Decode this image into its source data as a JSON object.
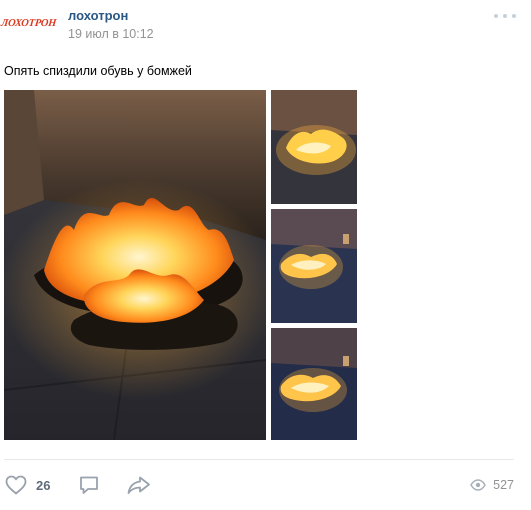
{
  "post": {
    "author": {
      "logo_text": "ЛОХОТРОН",
      "name": "лохотрон"
    },
    "date": "19 июл в 10:12",
    "menu_icon": "more-horizontal-icon",
    "text": "Опять спиздили обувь у бомжей",
    "photos": [
      {
        "role": "main",
        "subject": "burning shoes on pavement"
      },
      {
        "role": "thumbnail",
        "subject": "burning shoes"
      },
      {
        "role": "thumbnail",
        "subject": "burning shoes"
      },
      {
        "role": "thumbnail",
        "subject": "burning shoes"
      }
    ],
    "actions": {
      "like_icon": "heart-icon",
      "likes": "26",
      "comment_icon": "comment-icon",
      "share_icon": "share-arrow-icon",
      "views_icon": "eye-icon",
      "views": "527"
    }
  },
  "colors": {
    "author_link": "#2a5885",
    "secondary_text": "#939393",
    "action_icon": "#99a2ad",
    "logo": "#d93a22"
  }
}
